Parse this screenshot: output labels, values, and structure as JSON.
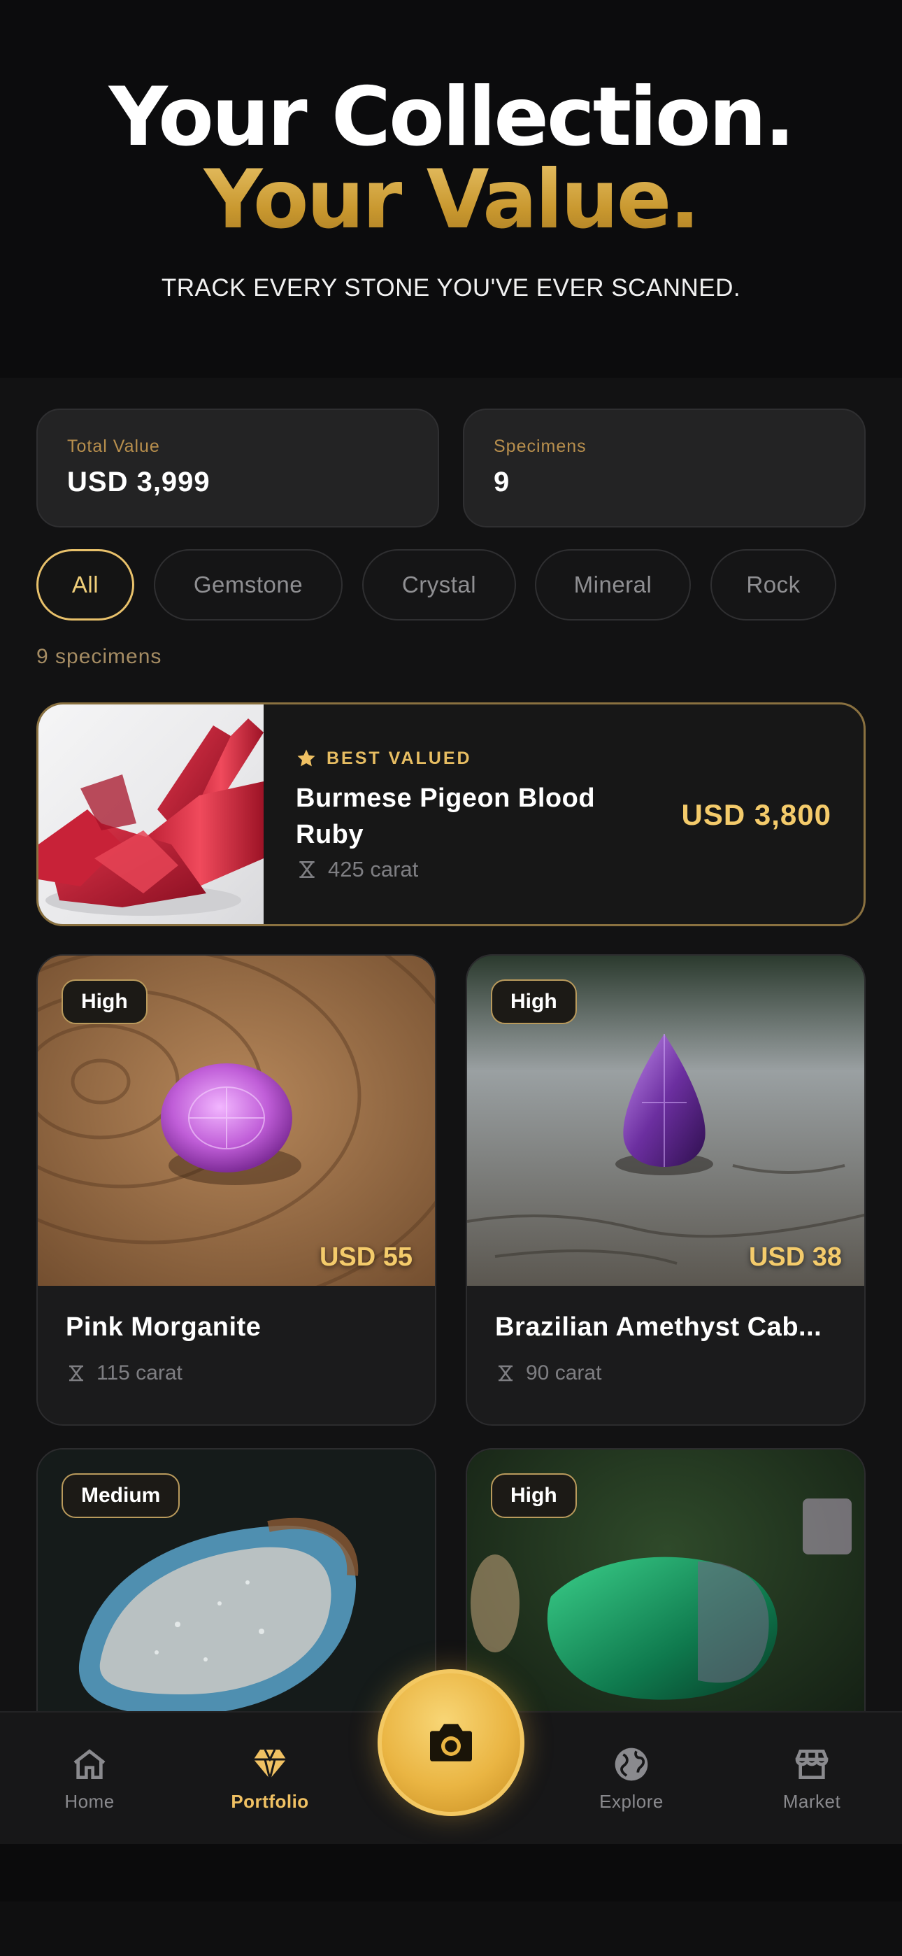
{
  "hero": {
    "line1": "Your Collection.",
    "line2": "Your Value.",
    "subtitle": "TRACK EVERY STONE YOU'VE EVER SCANNED."
  },
  "stats": {
    "total_value_label": "Total Value",
    "total_value": "USD 3,999",
    "specimens_label": "Specimens",
    "specimens": "9"
  },
  "filters": [
    "All",
    "Gemstone",
    "Crystal",
    "Mineral",
    "Rock"
  ],
  "active_filter": "All",
  "count_text": "9 specimens",
  "featured": {
    "badge": "BEST VALUED",
    "title": "Burmese Pigeon Blood Ruby",
    "carat": "425 carat",
    "price": "USD 3,800"
  },
  "cards": [
    {
      "tag": "High",
      "price": "USD 55",
      "title": "Pink Morganite",
      "carat": "115 carat"
    },
    {
      "tag": "High",
      "price": "USD 38",
      "title": "Brazilian Amethyst Cab...",
      "carat": "90 carat"
    },
    {
      "tag": "Medium"
    },
    {
      "tag": "High"
    }
  ],
  "tabbar": {
    "home": "Home",
    "portfolio": "Portfolio",
    "explore": "Explore",
    "market": "Market",
    "active": "Portfolio"
  },
  "colors": {
    "accent_gold": "#f0c163",
    "background": "#121213",
    "card": "#1b1b1c"
  }
}
